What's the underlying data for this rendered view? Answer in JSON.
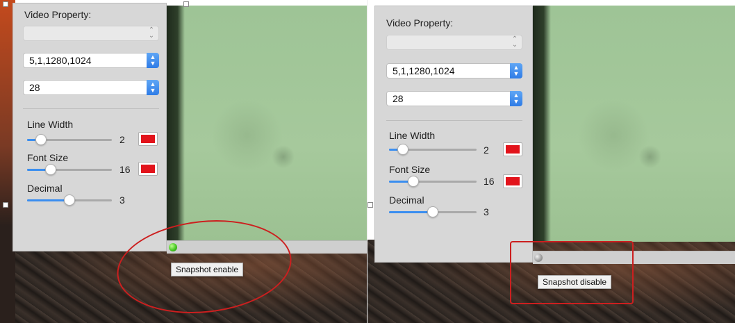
{
  "colors": {
    "accent": "#3a8ef0",
    "swatch_color": "#e2131b",
    "annotation_red": "#cc1f1f",
    "led_on": "#3fc11c",
    "led_off": "#9a9a9a"
  },
  "left": {
    "panel": {
      "title": "Video Property:",
      "source_select": {
        "value": "",
        "icon": "up-down-chevron-icon"
      },
      "resolution_select": {
        "value": "5,1,1280,1024",
        "icon": "up-down-chevron-icon"
      },
      "fps_select": {
        "value": "28",
        "icon": "up-down-chevron-icon"
      },
      "line_width": {
        "label": "Line Width",
        "value": "2",
        "level": 0.1
      },
      "font_size": {
        "label": "Font Size",
        "value": "16",
        "level": 0.28
      },
      "decimal": {
        "label": "Decimal",
        "value": "3",
        "level": 0.5
      }
    },
    "snapshot": {
      "tooltip": "Snapshot enable",
      "state": "enabled"
    }
  },
  "right": {
    "panel": {
      "title": "Video Property:",
      "source_select": {
        "value": "",
        "icon": "up-down-chevron-icon"
      },
      "resolution_select": {
        "value": "5,1,1280,1024",
        "icon": "up-down-chevron-icon"
      },
      "fps_select": {
        "value": "28",
        "icon": "up-down-chevron-icon"
      },
      "line_width": {
        "label": "Line Width",
        "value": "2",
        "level": 0.1
      },
      "font_size": {
        "label": "Font Size",
        "value": "16",
        "level": 0.28
      },
      "decimal": {
        "label": "Decimal",
        "value": "3",
        "level": 0.5
      }
    },
    "snapshot": {
      "tooltip": "Snapshot disable",
      "state": "disabled"
    }
  }
}
